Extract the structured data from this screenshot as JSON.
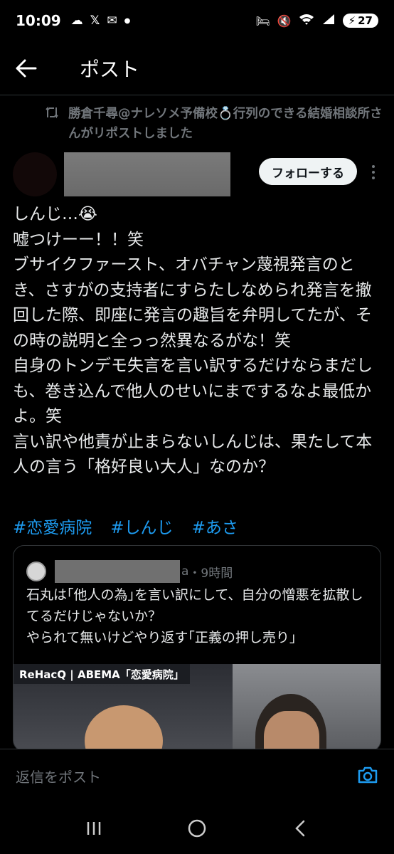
{
  "status_bar": {
    "time": "10:09",
    "battery_level": "27",
    "icons": [
      "cloud-icon",
      "x-logo-icon",
      "mail-icon",
      "dot-icon",
      "bed-icon",
      "mute-icon",
      "wifi-icon",
      "signal-icon"
    ]
  },
  "header": {
    "title": "ポスト"
  },
  "repost": {
    "text": "勝倉千尋@ナレソメ予備校💍行列のできる結婚相談所さんがリポストしました"
  },
  "author": {
    "follow_label": "フォローする"
  },
  "tweet": {
    "body": "しんじ…😭\n嘘つけーー！！笑\nブサイクファースト、オバチャン蔑視発言のとき、さすがの支持者にすらたしなめられ発言を撤回した際、即座に発言の趣旨を弁明してたが、その時の説明と全っっ然異なるがな！笑\n自身のトンデモ失言を言い訳するだけならまだしも、巻き込んで他人のせいにまでするなよ最低かよ。笑\n言い訳や他責が止まらないしんじは、果たして本人の言う「格好良い大人」なのか？",
    "hashtags": [
      "#恋愛病院",
      "#しんじ",
      "#あさ"
    ]
  },
  "quote": {
    "handle_suffix": "a",
    "time": "・9時間",
    "text": "石丸は｢他人の為｣を言い訳にして、自分の憎悪を拡散してるだけじゃないか？\nやられて無いけどやり返す｢正義の押し売り｣",
    "image_caption": "ReHacQ | ABEMA「恋愛病院」"
  },
  "reply": {
    "placeholder": "返信をポスト"
  },
  "colors": {
    "background": "#000000",
    "text": "#e7e9ea",
    "muted": "#71767b",
    "link": "#1d9bf0",
    "border": "#2f3336"
  }
}
